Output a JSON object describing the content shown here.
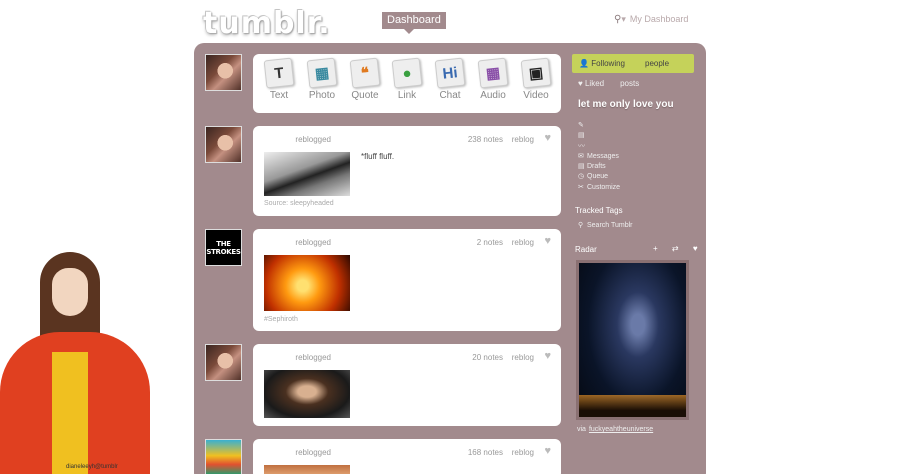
{
  "header": {
    "logo": "tumblr.",
    "dashboard_tab": "Dashboard",
    "search_label": "My Dashboard",
    "search_arrow": "▾"
  },
  "compose": [
    {
      "label": "Text",
      "icon": "T",
      "color": "#333"
    },
    {
      "label": "Photo",
      "icon": "▦",
      "color": "#3a8aa0"
    },
    {
      "label": "Quote",
      "icon": "❝",
      "color": "#e07a20"
    },
    {
      "label": "Link",
      "icon": "●",
      "color": "#3aa040"
    },
    {
      "label": "Chat",
      "icon": "Hi",
      "color": "#3a6ab0"
    },
    {
      "label": "Audio",
      "icon": "▦",
      "color": "#8a50a8"
    },
    {
      "label": "Video",
      "icon": "▣",
      "color": "#222"
    }
  ],
  "posts": [
    {
      "action": "reblogged",
      "notes": "238 notes",
      "reblog": "reblog",
      "quote": "*fluff fluff.",
      "source": "Source: sleepyheaded"
    },
    {
      "action": "reblogged",
      "notes": "2 notes",
      "reblog": "reblog",
      "tag": "#Sephiroth"
    },
    {
      "action": "reblogged",
      "notes": "20 notes",
      "reblog": "reblog"
    },
    {
      "action": "reblogged",
      "notes": "168 notes",
      "reblog": "reblog"
    }
  ],
  "strokes_avatar": "THE STROKES",
  "sidebar": {
    "following": "Following",
    "people": "people",
    "liked": "Liked",
    "liked_posts": "posts",
    "blog_title": "let me only love you",
    "links": [
      "Messages",
      "Drafts",
      "Queue",
      "Customize"
    ],
    "tracked_tags": "Tracked Tags",
    "search_tumblr": "Search Tumblr",
    "radar": "Radar",
    "radar_icons": "+ ⇄ ♥",
    "via": "via",
    "via_user": "fuckyeahtheuniverse"
  },
  "watermark": "dianeleeyh@tumblr"
}
